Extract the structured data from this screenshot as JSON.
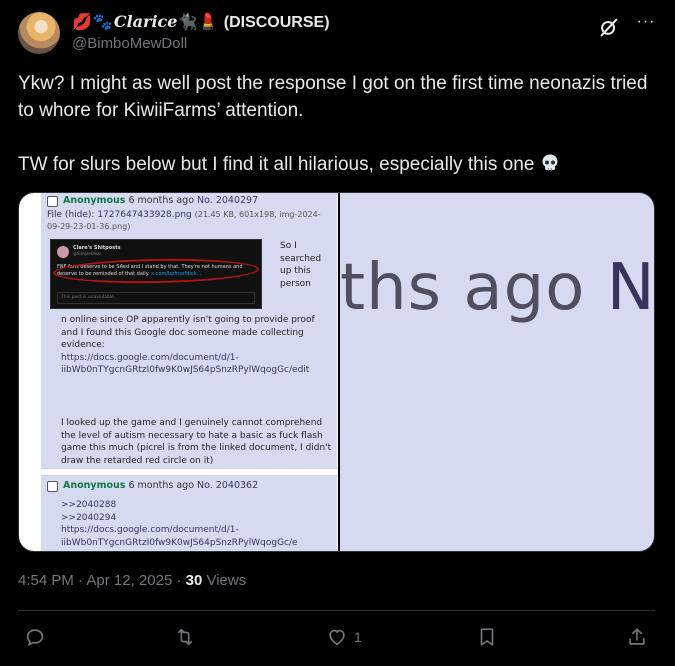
{
  "author": {
    "display_name_prefix": "💋🐾",
    "display_name_main": "Clarice",
    "display_name_suffix": "🐈‍⬛💄",
    "display_name_tag": "(DISCOURSE)",
    "handle": "@BimboMewDoll"
  },
  "tweet": {
    "line1": "Ykw?  I might as well post the response I got on the first time neonazis tried to whore for KiwiiFarms’ attention.",
    "line2": "TW for slurs below but I find it all hilarious, especially this one"
  },
  "media": {
    "post1": {
      "name": "Anonymous",
      "ago": "6 months ago",
      "no": "No. 2040297",
      "file_prefix": "File (",
      "file_hide": "hide",
      "file_mid": "): ",
      "file_name": "1727647433928.png",
      "file_meta": "(21.45 KB, 601x198, img-2024-09-29-23-01-36.png)",
      "thumb_title": "Clare's Shitposts",
      "thumb_handle": "@SimpleOlive",
      "thumb_body": "FNF fans deserve to be SAed and I stand by that. They're not humans and deserve to be reminded of that daily.",
      "thumb_link": "x.com/bpfnssfdick...",
      "thumb_footer": "This post is unavailable.",
      "side_text": "So I searched up this person",
      "body1": "n online since OP apparently isn't going to provide proof and I found this Google doc someone made collecting evidence:",
      "link": "https://docs.google.com/document/d/1-iibWb0nTYgcnGRtzI0fw9K0wJS64pSnzRPylWqogGc/edit",
      "body2": "I looked up the game and I genuinely cannot comprehend the level of autism necessary to hate a basic as fuck flash game this much (picrel is from the linked document, I didn't draw the retarded red circle on it)"
    },
    "post2": {
      "name": "Anonymous",
      "ago": "6 months ago",
      "no": "No. 2040362",
      "quote1": ">>2040288",
      "quote2": ">>2040294",
      "link": "https://docs.google.com/document/d/1-iibWb0nTYgcnGRtzI0fw9K0wJS64pSnzRPylWqogGc/e"
    },
    "zoom_text_gray": "ths ago ",
    "zoom_text_blue": "N"
  },
  "meta": {
    "time": "4:54 PM",
    "sep1": " · ",
    "date": "Apr 12, 2025",
    "sep2": " · ",
    "views_count": "30",
    "views_label": " Views"
  },
  "actions": {
    "likes": "1"
  }
}
